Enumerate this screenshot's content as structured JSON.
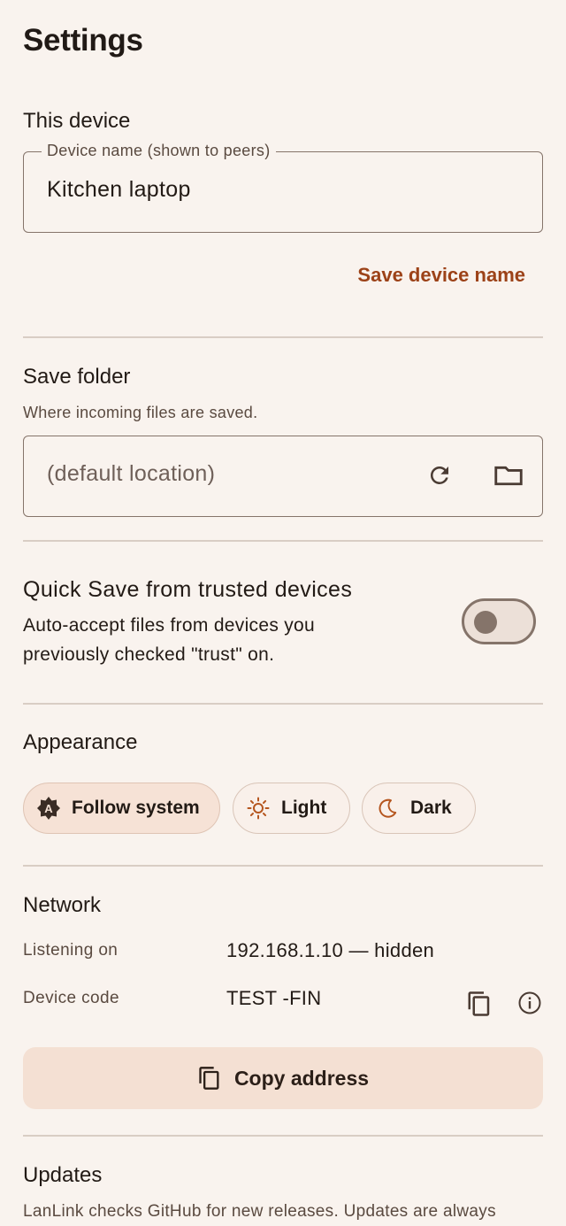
{
  "page": {
    "title": "Settings"
  },
  "this_device": {
    "heading": "This device",
    "field_label": "Device name (shown to peers)",
    "field_value": "Kitchen laptop",
    "save_label": "Save device name"
  },
  "save_folder": {
    "heading": "Save folder",
    "description": "Where incoming files are saved.",
    "placeholder": "(default location)",
    "reset_icon": "refresh-icon",
    "browse_icon": "folder-icon"
  },
  "quick_save": {
    "title": "Quick Save from trusted devices",
    "description": "Auto-accept files from devices you previously checked \"trust\" on.",
    "enabled": false
  },
  "appearance": {
    "heading": "Appearance",
    "options": [
      {
        "label": "Follow system",
        "icon": "auto-theme-icon",
        "selected": true
      },
      {
        "label": "Light",
        "icon": "sun-icon",
        "selected": false
      },
      {
        "label": "Dark",
        "icon": "moon-icon",
        "selected": false
      }
    ]
  },
  "network": {
    "heading": "Network",
    "listening_label": "Listening on",
    "listening_value": "192.168.1.10 — hidden",
    "device_code_label": "Device code",
    "device_code_value": "TEST -FIN",
    "copy_address_label": "Copy address"
  },
  "updates": {
    "heading": "Updates",
    "description": "LanLink checks GitHub for new releases. Updates are always"
  },
  "colors": {
    "background": "#f9f3ee",
    "accent": "#9c4218",
    "tonal_container": "#f4e0d3",
    "outline": "#85746a"
  }
}
